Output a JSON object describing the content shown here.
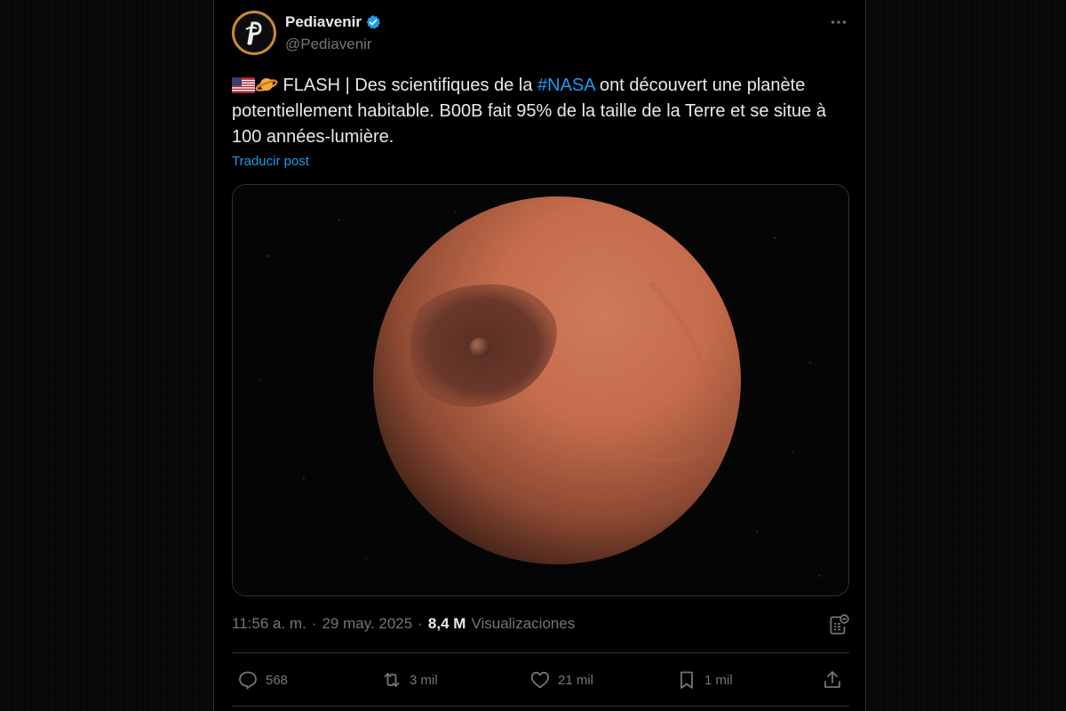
{
  "tweet": {
    "author_name": "Pediavenir",
    "author_handle": "@Pediavenir",
    "text_before_hashtag": " FLASH | Des scientifiques de la ",
    "hashtag": "#NASA",
    "text_after_hashtag": " ont découvert une planète potentiellement habitable. B00B fait 95% de la taille de la Terre et se situe à 100 années-lumière.",
    "translate_label": "Traducir post",
    "time": "11:56 a. m.",
    "separator": "·",
    "date": "29 may. 2025",
    "views_count": "8,4 M",
    "views_label": "Visualizaciones"
  },
  "actions": {
    "replies": "568",
    "reposts": "3 mil",
    "likes": "21 mil",
    "bookmarks": "1 mil"
  },
  "icons": [
    "verified-badge-icon",
    "more-options-icon",
    "us-flag-emoji-icon",
    "ringed-planet-emoji-icon",
    "post-analytics-icon",
    "reply-icon",
    "repost-icon",
    "like-icon",
    "bookmark-icon",
    "share-icon"
  ],
  "colors": {
    "background": "#000000",
    "text": "#e7e9ea",
    "secondary_text": "#71767b",
    "link": "#1d9bf0",
    "border": "#2f3336",
    "planet": "#c56a4a"
  }
}
